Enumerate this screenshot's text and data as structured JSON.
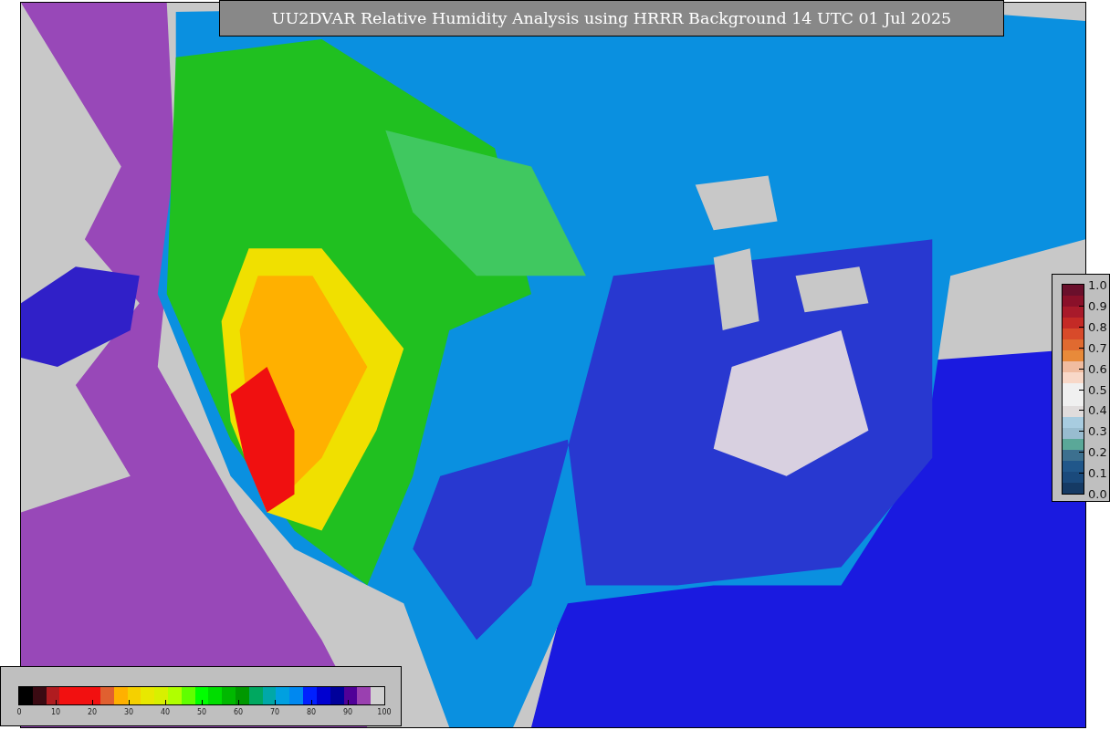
{
  "title": "UU2DVAR Relative Humidity Analysis using HRRR Background 14 UTC 01 Jul 2025",
  "humidity_legend": {
    "ticks": [
      "0",
      "10",
      "20",
      "30",
      "40",
      "50",
      "60",
      "70",
      "80",
      "90",
      "100"
    ],
    "bands": [
      {
        "color": "#000000"
      },
      {
        "color": "#3a0a12"
      },
      {
        "color": "#b01c20"
      },
      {
        "color": "#f21010"
      },
      {
        "color": "#f21010"
      },
      {
        "color": "#f21010"
      },
      {
        "color": "#e06030"
      },
      {
        "color": "#ffb000"
      },
      {
        "color": "#f5d000"
      },
      {
        "color": "#e8e800"
      },
      {
        "color": "#d8f000"
      },
      {
        "color": "#b0ff00"
      },
      {
        "color": "#60ff00"
      },
      {
        "color": "#00ff00"
      },
      {
        "color": "#00dd00"
      },
      {
        "color": "#00b800"
      },
      {
        "color": "#009800"
      },
      {
        "color": "#00a860"
      },
      {
        "color": "#00a8a8"
      },
      {
        "color": "#00a0e0"
      },
      {
        "color": "#0088f0"
      },
      {
        "color": "#0020ff"
      },
      {
        "color": "#0000d0"
      },
      {
        "color": "#00009a"
      },
      {
        "color": "#500098"
      },
      {
        "color": "#9a40b0"
      },
      {
        "color": "#d0d0d0"
      }
    ]
  },
  "error_legend": {
    "ticks": [
      "1.0",
      "0.9",
      "0.8",
      "0.7",
      "0.6",
      "0.5",
      "0.4",
      "0.3",
      "0.2",
      "0.1",
      "0.0"
    ],
    "bands": [
      {
        "color": "#6a0f2b"
      },
      {
        "color": "#8a1029"
      },
      {
        "color": "#a81a2a"
      },
      {
        "color": "#c42a26"
      },
      {
        "color": "#d84a2a"
      },
      {
        "color": "#e06a30"
      },
      {
        "color": "#e88a3a"
      },
      {
        "color": "#f0bca0"
      },
      {
        "color": "#f8d8c8"
      },
      {
        "color": "#f0f0f0"
      },
      {
        "color": "#f0f0f0"
      },
      {
        "color": "#e0dcdc"
      },
      {
        "color": "#a8cce0"
      },
      {
        "color": "#98bccf"
      },
      {
        "color": "#5aa898"
      },
      {
        "color": "#3c708f"
      },
      {
        "color": "#20578a"
      },
      {
        "color": "#1a4a7c"
      },
      {
        "color": "#153a64"
      }
    ]
  }
}
